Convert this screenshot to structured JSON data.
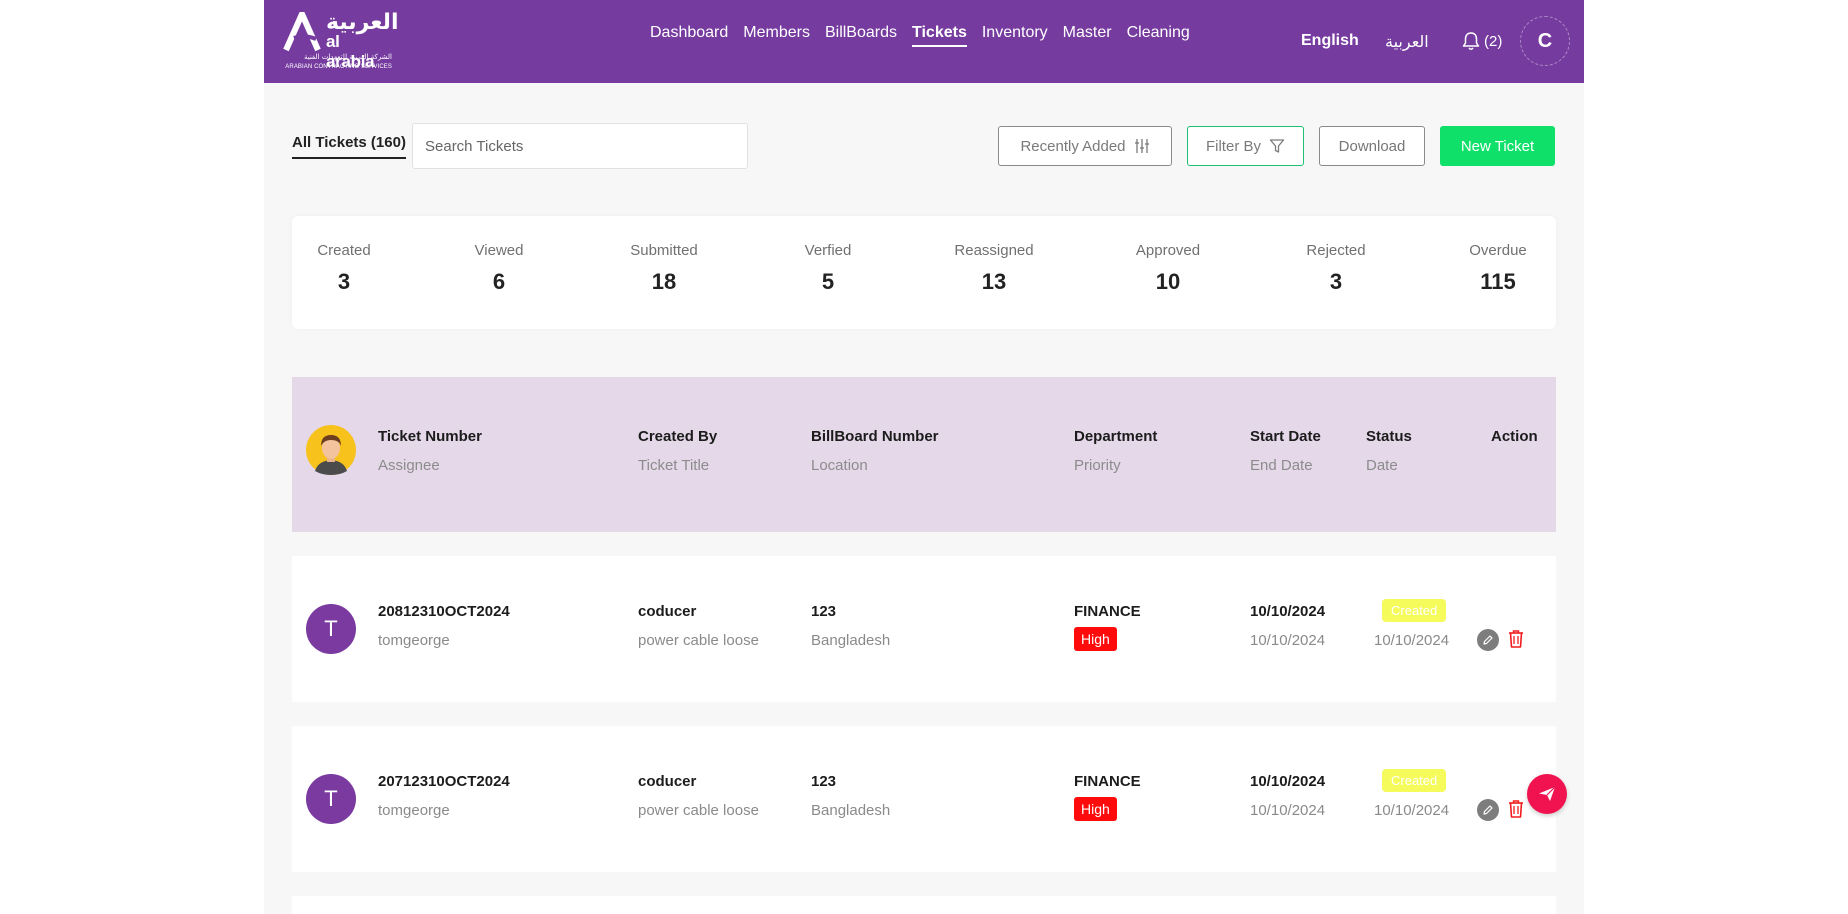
{
  "brand": {
    "arabic_name": "العربية",
    "english_name": "al arabia",
    "subtitle_arabic": "الشركة العربية للتعهدات الفنية",
    "subtitle_english": "ARABIAN CONTRACTING SERVICES"
  },
  "nav": {
    "items": [
      "Dashboard",
      "Members",
      "BillBoards",
      "Tickets",
      "Inventory",
      "Master",
      "Cleaning"
    ],
    "active": "Tickets"
  },
  "header": {
    "lang_english": "English",
    "lang_arabic": "العربية",
    "notifications": "(2)",
    "user_initial": "C"
  },
  "toolbar": {
    "all_tickets": "All Tickets (160)",
    "search_placeholder": "Search Tickets",
    "recent_label": "Recently Added",
    "filter_label": "Filter By",
    "download_label": "Download",
    "new_ticket_label": "New Ticket"
  },
  "stats": [
    {
      "label": "Created",
      "value": "3"
    },
    {
      "label": "Viewed",
      "value": "6"
    },
    {
      "label": "Submitted",
      "value": "18"
    },
    {
      "label": "Verfied",
      "value": "5"
    },
    {
      "label": "Reassigned",
      "value": "13"
    },
    {
      "label": "Approved",
      "value": "10"
    },
    {
      "label": "Rejected",
      "value": "3"
    },
    {
      "label": "Overdue",
      "value": "115"
    }
  ],
  "table_header": {
    "ticket_number": "Ticket Number",
    "assignee": "Assignee",
    "created_by": "Created By",
    "ticket_title": "Ticket Title",
    "billboard_number": "BillBoard Number",
    "location": "Location",
    "department": "Department",
    "priority": "Priority",
    "start_date": "Start Date",
    "end_date": "End Date",
    "status": "Status",
    "date": "Date",
    "action": "Action"
  },
  "rows": [
    {
      "initial": "T",
      "ticket_number": "20812310OCT2024",
      "assignee": "tomgeorge",
      "created_by": "coducer",
      "ticket_title": "power cable loose",
      "billboard_number": "123",
      "location": "Bangladesh",
      "department": "FINANCE",
      "priority": "High",
      "start_date": "10/10/2024",
      "end_date": "10/10/2024",
      "status": "Created",
      "status_date": "10/10/2024"
    },
    {
      "initial": "T",
      "ticket_number": "20712310OCT2024",
      "assignee": "tomgeorge",
      "created_by": "coducer",
      "ticket_title": "power cable loose",
      "billboard_number": "123",
      "location": "Bangladesh",
      "department": "FINANCE",
      "priority": "High",
      "start_date": "10/10/2024",
      "end_date": "10/10/2024",
      "status": "Created",
      "status_date": "10/10/2024"
    }
  ],
  "colors": {
    "header_bg": "#763b9f",
    "table_header_bg": "#e4d8e9",
    "new_ticket": "#0fe06a",
    "priority_high": "#ff0b0b",
    "status_created": "#f4fb5a",
    "fab": "#f0134f"
  },
  "icons": {
    "notification": "bell-icon",
    "sort": "sort-sliders-icon",
    "filter": "funnel-icon",
    "edit": "pencil-icon",
    "delete": "trash-icon",
    "fab": "send-icon"
  }
}
